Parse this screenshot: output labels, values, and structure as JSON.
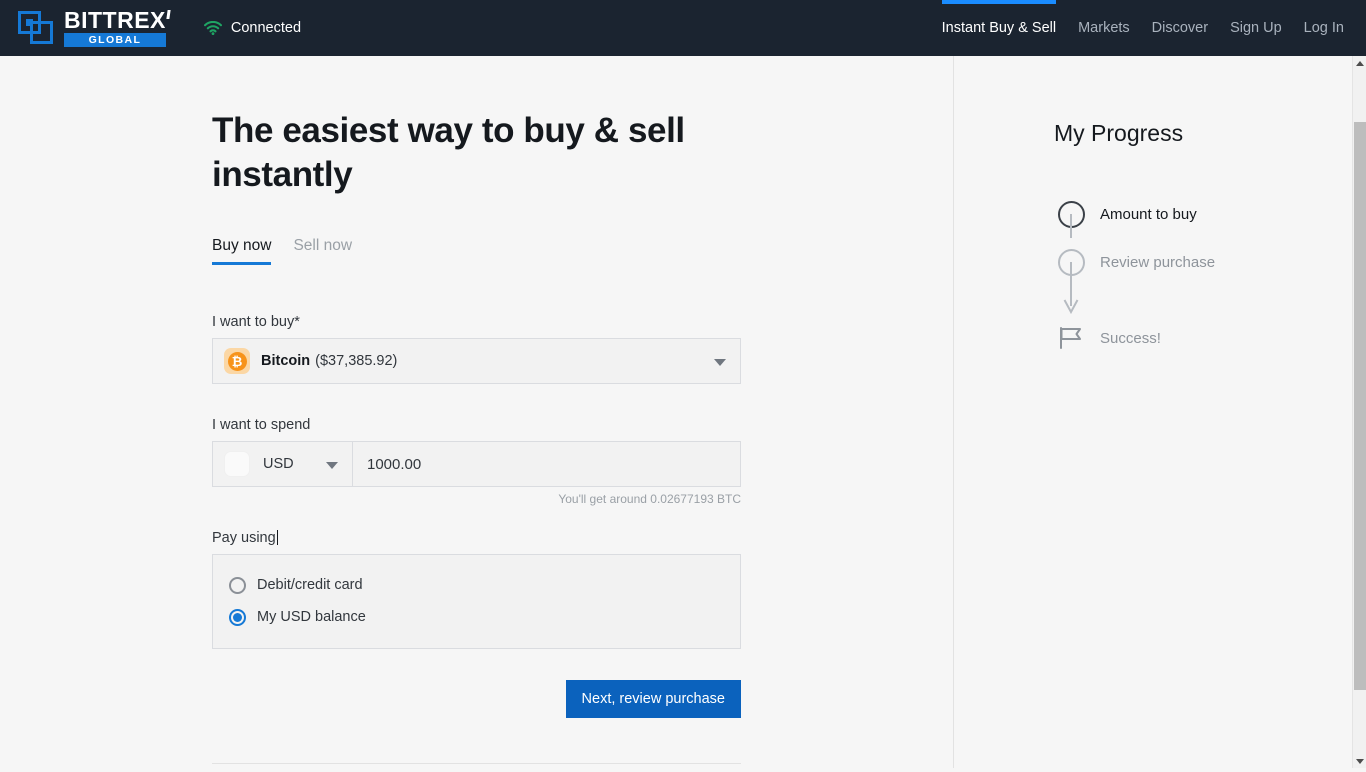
{
  "header": {
    "brand": {
      "word": "BITTREX",
      "sub": "GLOBAL",
      "logo_icon": "bittrex-logo-icon"
    },
    "connection": {
      "icon": "wifi-icon",
      "label": "Connected"
    },
    "nav": [
      {
        "label": "Instant Buy & Sell",
        "active": true
      },
      {
        "label": "Markets",
        "active": false
      },
      {
        "label": "Discover",
        "active": false
      },
      {
        "label": "Sign Up",
        "active": false
      },
      {
        "label": "Log In",
        "active": false
      }
    ]
  },
  "main": {
    "title": "The easiest way to buy & sell instantly",
    "tabs": [
      {
        "label": "Buy now",
        "active": true
      },
      {
        "label": "Sell now",
        "active": false
      }
    ],
    "buy": {
      "label": "I want to buy*",
      "coin_icon": "bitcoin-icon",
      "coin_glyph": "₿",
      "coin_name": "Bitcoin",
      "coin_price": "($37,385.92)",
      "caret_icon": "chevron-down-icon"
    },
    "spend": {
      "label": "I want to spend",
      "currency": "USD",
      "currency_flag_icon": "flag-placeholder-icon",
      "amount_value": "1000.00",
      "amount_placeholder": "0.00",
      "hint": "You'll get around 0.02677193 BTC"
    },
    "pay": {
      "label": "Pay using",
      "options": [
        {
          "label": "Debit/credit card",
          "selected": false
        },
        {
          "label": "My USD balance",
          "selected": true
        }
      ]
    },
    "next_button": "Next, review purchase",
    "fineprint": ""
  },
  "progress": {
    "title": "My Progress",
    "steps": [
      {
        "label": "Amount to buy",
        "state": "active",
        "marker": "circle"
      },
      {
        "label": "Review purchase",
        "state": "pending",
        "marker": "circle"
      },
      {
        "label": "Success!",
        "state": "pending",
        "marker": "flag"
      }
    ]
  },
  "scrollbar": {
    "up_icon": "scroll-up-arrow-icon",
    "down_icon": "scroll-down-arrow-icon"
  },
  "colors": {
    "header_bg": "#1b2430",
    "accent_blue": "#1579d6",
    "nav_active_bar": "#1a8cff",
    "button_blue": "#0b62bd",
    "bitcoin_orange": "#f7931a",
    "connected_green": "#1fa463",
    "page_bg": "#f6f6f6"
  }
}
